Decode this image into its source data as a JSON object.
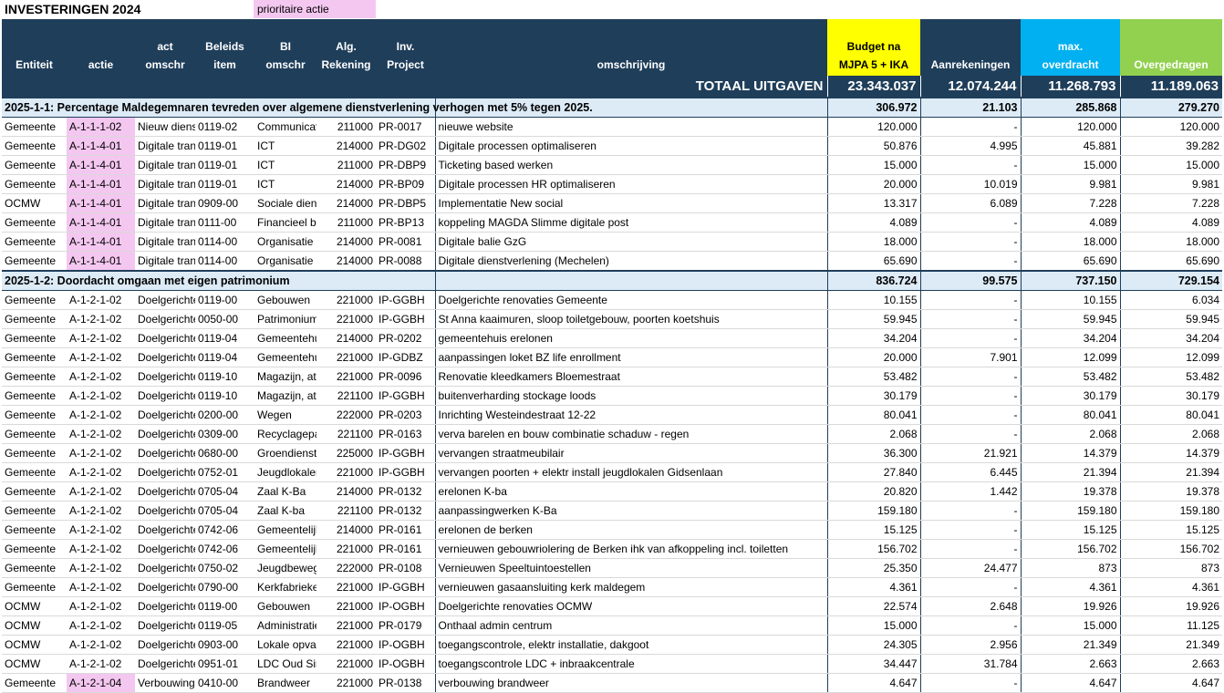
{
  "page": {
    "title": "INVESTERINGEN 2024",
    "legend": "prioritaire actie"
  },
  "columns": {
    "entiteit": "Entiteit",
    "actie": "actie",
    "act_omschr": [
      "act",
      "omschr"
    ],
    "beleidsitem": [
      "Beleids",
      "item"
    ],
    "bi_omschr": [
      "BI",
      "omschr"
    ],
    "alg_rekening": [
      "Alg.",
      "Rekening"
    ],
    "inv_project": [
      "Inv.",
      "Project"
    ],
    "omschrijving": "omschrijving",
    "budget": [
      "Budget na",
      "MJPA 5 + IKA"
    ],
    "aanrekeningen": "Aanrekeningen",
    "max_overdracht": [
      "max.",
      "overdracht"
    ],
    "overgedragen": "Overgedragen"
  },
  "colors": {
    "header": "#1f3e5a",
    "budget": "#ffff00",
    "max": "#00b0f0",
    "overgedragen": "#92d050",
    "priority": "#f4c7f0",
    "group": "#ddebf7"
  },
  "total": {
    "label": "TOTAAL UITGAVEN",
    "budget": "23.343.037",
    "aanrekeningen": "12.074.244",
    "max": "11.268.793",
    "overgedragen": "11.189.063"
  },
  "groups": [
    {
      "label": "2025-1-1: Percentage Maldegemnaren tevreden over algemene dienstverlening verhogen met 5% tegen 2025.",
      "budget": "306.972",
      "aanrekeningen": "21.103",
      "max": "285.868",
      "overgedragen": "279.270",
      "rows": [
        {
          "e": "Gemeente",
          "a": "A-1-1-1-02",
          "p": true,
          "ao": "Nieuw dienstverlening",
          "bi": "0119-02",
          "bo": "Communicatie",
          "r": "211000",
          "ip": "PR-0017",
          "d": "nieuwe website",
          "b": "120.000",
          "an": "-",
          "m": "120.000",
          "o": "120.000"
        },
        {
          "e": "Gemeente",
          "a": "A-1-1-4-01",
          "p": true,
          "ao": "Digitale transformatie",
          "bi": "0119-01",
          "bo": "ICT",
          "r": "214000",
          "ip": "PR-DG02",
          "d": "Digitale processen optimaliseren",
          "b": "50.876",
          "an": "4.995",
          "m": "45.881",
          "o": "39.282"
        },
        {
          "e": "Gemeente",
          "a": "A-1-1-4-01",
          "p": true,
          "ao": "Digitale transformatie",
          "bi": "0119-01",
          "bo": "ICT",
          "r": "211000",
          "ip": "PR-DBP9",
          "d": "Ticketing based werken",
          "b": "15.000",
          "an": "-",
          "m": "15.000",
          "o": "15.000"
        },
        {
          "e": "Gemeente",
          "a": "A-1-1-4-01",
          "p": true,
          "ao": "Digitale transformatie",
          "bi": "0119-01",
          "bo": "ICT",
          "r": "214000",
          "ip": "PR-BP09",
          "d": "Digitale processen HR optimaliseren",
          "b": "20.000",
          "an": "10.019",
          "m": "9.981",
          "o": "9.981"
        },
        {
          "e": "OCMW",
          "a": "A-1-1-4-01",
          "p": true,
          "ao": "Digitale transformatie",
          "bi": "0909-00",
          "bo": "Sociale dienst",
          "r": "214000",
          "ip": "PR-DBP5",
          "d": "Implementatie New social",
          "b": "13.317",
          "an": "6.089",
          "m": "7.228",
          "o": "7.228"
        },
        {
          "e": "Gemeente",
          "a": "A-1-1-4-01",
          "p": true,
          "ao": "Digitale transformatie",
          "bi": "0111-00",
          "bo": "Financieel beleid",
          "r": "211000",
          "ip": "PR-BP13",
          "d": "koppeling MAGDA Slimme digitale post",
          "b": "4.089",
          "an": "-",
          "m": "4.089",
          "o": "4.089"
        },
        {
          "e": "Gemeente",
          "a": "A-1-1-4-01",
          "p": true,
          "ao": "Digitale transformatie",
          "bi": "0114-00",
          "bo": "Organisatie",
          "r": "214000",
          "ip": "PR-0081",
          "d": "Digitale balie GzG",
          "b": "18.000",
          "an": "-",
          "m": "18.000",
          "o": "18.000"
        },
        {
          "e": "Gemeente",
          "a": "A-1-1-4-01",
          "p": true,
          "ao": "Digitale transformatie",
          "bi": "0114-00",
          "bo": "Organisatie",
          "r": "214000",
          "ip": "PR-0088",
          "d": "Digitale dienstverlening (Mechelen)",
          "b": "65.690",
          "an": "-",
          "m": "65.690",
          "o": "65.690"
        }
      ]
    },
    {
      "label": "2025-1-2: Doordacht omgaan met eigen patrimonium",
      "budget": "836.724",
      "aanrekeningen": "99.575",
      "max": "737.150",
      "overgedragen": "729.154",
      "rows": [
        {
          "e": "Gemeente",
          "a": "A-1-2-1-02",
          "p": false,
          "ao": "Doelgerichte renovaties",
          "bi": "0119-00",
          "bo": "Gebouwen",
          "r": "221000",
          "ip": "IP-GGBH",
          "d": "Doelgerichte renovaties Gemeente",
          "b": "10.155",
          "an": "-",
          "m": "10.155",
          "o": "6.034"
        },
        {
          "e": "Gemeente",
          "a": "A-1-2-1-02",
          "p": false,
          "ao": "Doelgerichte renovaties",
          "bi": "0050-00",
          "bo": "Patrimonium",
          "r": "221000",
          "ip": "IP-GGBH",
          "d": "St Anna kaaimuren, sloop toiletgebouw, poorten koetshuis",
          "b": "59.945",
          "an": "-",
          "m": "59.945",
          "o": "59.945"
        },
        {
          "e": "Gemeente",
          "a": "A-1-2-1-02",
          "p": false,
          "ao": "Doelgerichte renovaties",
          "bi": "0119-04",
          "bo": "Gemeentehuis",
          "r": "214000",
          "ip": "PR-0202",
          "d": "gemeentehuis erelonen",
          "b": "34.204",
          "an": "-",
          "m": "34.204",
          "o": "34.204"
        },
        {
          "e": "Gemeente",
          "a": "A-1-2-1-02",
          "p": false,
          "ao": "Doelgerichte renovaties",
          "bi": "0119-04",
          "bo": "Gemeentehuis",
          "r": "221000",
          "ip": "IP-GDBZ",
          "d": "aanpassingen loket BZ life enrollment",
          "b": "20.000",
          "an": "7.901",
          "m": "12.099",
          "o": "12.099"
        },
        {
          "e": "Gemeente",
          "a": "A-1-2-1-02",
          "p": false,
          "ao": "Doelgerichte renovaties",
          "bi": "0119-10",
          "bo": "Magazijn, atelier",
          "r": "221000",
          "ip": "PR-0096",
          "d": "Renovatie kleedkamers Bloemestraat",
          "b": "53.482",
          "an": "-",
          "m": "53.482",
          "o": "53.482"
        },
        {
          "e": "Gemeente",
          "a": "A-1-2-1-02",
          "p": false,
          "ao": "Doelgerichte renovaties",
          "bi": "0119-10",
          "bo": "Magazijn, atelier",
          "r": "221100",
          "ip": "IP-GGBH",
          "d": "buitenverharding stockage loods",
          "b": "30.179",
          "an": "-",
          "m": "30.179",
          "o": "30.179"
        },
        {
          "e": "Gemeente",
          "a": "A-1-2-1-02",
          "p": false,
          "ao": "Doelgerichte renovaties",
          "bi": "0200-00",
          "bo": "Wegen",
          "r": "222000",
          "ip": "PR-0203",
          "d": "Inrichting Westeindestraat 12-22",
          "b": "80.041",
          "an": "-",
          "m": "80.041",
          "o": "80.041"
        },
        {
          "e": "Gemeente",
          "a": "A-1-2-1-02",
          "p": false,
          "ao": "Doelgerichte renovaties",
          "bi": "0309-00",
          "bo": "Recyclagepark",
          "r": "221100",
          "ip": "PR-0163",
          "d": "verva barelen en bouw combinatie schaduw - regen",
          "b": "2.068",
          "an": "-",
          "m": "2.068",
          "o": "2.068"
        },
        {
          "e": "Gemeente",
          "a": "A-1-2-1-02",
          "p": false,
          "ao": "Doelgerichte renovaties",
          "bi": "0680-00",
          "bo": "Groendienst",
          "r": "225000",
          "ip": "IP-GGBH",
          "d": "vervangen straatmeubilair",
          "b": "36.300",
          "an": "21.921",
          "m": "14.379",
          "o": "14.379"
        },
        {
          "e": "Gemeente",
          "a": "A-1-2-1-02",
          "p": false,
          "ao": "Doelgerichte renovaties",
          "bi": "0752-01",
          "bo": "Jeugdlokalen",
          "r": "221000",
          "ip": "IP-GGBH",
          "d": "vervangen poorten + elektr install jeugdlokalen Gidsenlaan",
          "b": "27.840",
          "an": "6.445",
          "m": "21.394",
          "o": "21.394"
        },
        {
          "e": "Gemeente",
          "a": "A-1-2-1-02",
          "p": false,
          "ao": "Doelgerichte renovaties",
          "bi": "0705-04",
          "bo": "Zaal K-Ba",
          "r": "214000",
          "ip": "PR-0132",
          "d": "erelonen K-ba",
          "b": "20.820",
          "an": "1.442",
          "m": "19.378",
          "o": "19.378"
        },
        {
          "e": "Gemeente",
          "a": "A-1-2-1-02",
          "p": false,
          "ao": "Doelgerichte renovaties",
          "bi": "0705-04",
          "bo": "Zaal K-ba",
          "r": "221100",
          "ip": "PR-0132",
          "d": "aanpassingwerken K-Ba",
          "b": "159.180",
          "an": "-",
          "m": "159.180",
          "o": "159.180"
        },
        {
          "e": "Gemeente",
          "a": "A-1-2-1-02",
          "p": false,
          "ao": "Doelgerichte renovaties",
          "bi": "0742-06",
          "bo": "Gemeentelijke",
          "r": "214000",
          "ip": "PR-0161",
          "d": "erelonen de berken",
          "b": "15.125",
          "an": "-",
          "m": "15.125",
          "o": "15.125"
        },
        {
          "e": "Gemeente",
          "a": "A-1-2-1-02",
          "p": false,
          "ao": "Doelgerichte renovaties",
          "bi": "0742-06",
          "bo": "Gemeentelijke",
          "r": "221000",
          "ip": "PR-0161",
          "d": "vernieuwen gebouwriolering de Berken ihk van afkoppeling incl. toiletten",
          "b": "156.702",
          "an": "-",
          "m": "156.702",
          "o": "156.702"
        },
        {
          "e": "Gemeente",
          "a": "A-1-2-1-02",
          "p": false,
          "ao": "Doelgerichte renovaties",
          "bi": "0750-02",
          "bo": "Jeugdbeweging",
          "r": "222000",
          "ip": "PR-0108",
          "d": "Vernieuwen Speeltuintoestellen",
          "b": "25.350",
          "an": "24.477",
          "m": "873",
          "o": "873"
        },
        {
          "e": "Gemeente",
          "a": "A-1-2-1-02",
          "p": false,
          "ao": "Doelgerichte renovaties",
          "bi": "0790-00",
          "bo": "Kerkfabrieken",
          "r": "221000",
          "ip": "IP-GGBH",
          "d": "vernieuwen gasaansluiting kerk maldegem",
          "b": "4.361",
          "an": "-",
          "m": "4.361",
          "o": "4.361"
        },
        {
          "e": "OCMW",
          "a": "A-1-2-1-02",
          "p": false,
          "ao": "Doelgerichte renovaties",
          "bi": "0119-00",
          "bo": "Gebouwen",
          "r": "221000",
          "ip": "IP-OGBH",
          "d": "Doelgerichte renovaties OCMW",
          "b": "22.574",
          "an": "2.648",
          "m": "19.926",
          "o": "19.926"
        },
        {
          "e": "OCMW",
          "a": "A-1-2-1-02",
          "p": false,
          "ao": "Doelgerichte renovaties",
          "bi": "0119-05",
          "bo": "Administratie",
          "r": "221000",
          "ip": "PR-0179",
          "d": "Onthaal admin centrum",
          "b": "15.000",
          "an": "-",
          "m": "15.000",
          "o": "11.125"
        },
        {
          "e": "OCMW",
          "a": "A-1-2-1-02",
          "p": false,
          "ao": "Doelgerichte renovaties",
          "bi": "0903-00",
          "bo": "Lokale opvang",
          "r": "221000",
          "ip": "IP-OGBH",
          "d": "toegangscontrole, elektr installatie, dakgoot",
          "b": "24.305",
          "an": "2.956",
          "m": "21.349",
          "o": "21.349"
        },
        {
          "e": "OCMW",
          "a": "A-1-2-1-02",
          "p": false,
          "ao": "Doelgerichte renovaties",
          "bi": "0951-01",
          "bo": "LDC Oud Sint",
          "r": "221000",
          "ip": "IP-OGBH",
          "d": "toegangscontrole LDC + inbraakcentrale",
          "b": "34.447",
          "an": "31.784",
          "m": "2.663",
          "o": "2.663"
        },
        {
          "e": "Gemeente",
          "a": "A-1-2-1-04",
          "p": true,
          "ao": "Verbouwing brandweer",
          "bi": "0410-00",
          "bo": "Brandweer",
          "r": "221000",
          "ip": "PR-0138",
          "d": "verbouwing brandweer",
          "b": "4.647",
          "an": "-",
          "m": "4.647",
          "o": "4.647"
        }
      ]
    }
  ]
}
